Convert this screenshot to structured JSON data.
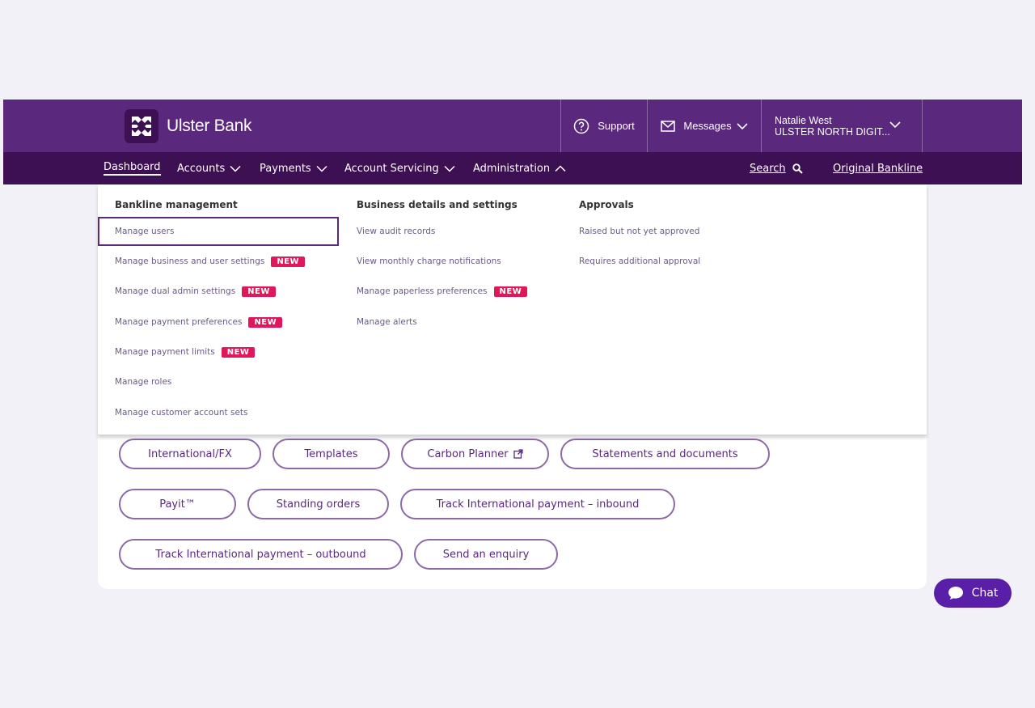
{
  "header": {
    "brand": "Ulster Bank",
    "support_label": "Support",
    "messages_label": "Messages",
    "user_name": "Natalie West",
    "company_name": "ULSTER NORTH DIGIT..."
  },
  "nav": {
    "dashboard": "Dashboard",
    "accounts": "Accounts",
    "payments": "Payments",
    "account_servicing": "Account Servicing",
    "administration": "Administration",
    "search": "Search",
    "original_bankline": "Original Bankline"
  },
  "dropdown": {
    "columns": [
      {
        "title": "Bankline management",
        "items": [
          {
            "label": "Manage users",
            "badge": ""
          },
          {
            "label": "Manage business and user settings",
            "badge": "NEW"
          },
          {
            "label": "Manage dual admin settings",
            "badge": "NEW"
          },
          {
            "label": "Manage payment preferences",
            "badge": "NEW"
          },
          {
            "label": "Manage payment limits",
            "badge": "NEW"
          },
          {
            "label": "Manage roles",
            "badge": ""
          },
          {
            "label": "Manage customer account sets",
            "badge": ""
          }
        ]
      },
      {
        "title": "Business details and settings",
        "items": [
          {
            "label": "View audit records",
            "badge": ""
          },
          {
            "label": "View monthly charge notifications",
            "badge": ""
          },
          {
            "label": "Manage paperless preferences",
            "badge": "NEW"
          },
          {
            "label": "Manage alerts",
            "badge": ""
          }
        ]
      },
      {
        "title": "Approvals",
        "items": [
          {
            "label": "Raised but not yet approved",
            "badge": ""
          },
          {
            "label": "Requires additional approval",
            "badge": ""
          }
        ]
      }
    ]
  },
  "quick_links": [
    "International/FX",
    "Templates",
    "Carbon Planner",
    "Statements and documents",
    "Payit™",
    "Standing orders",
    "Track International payment – inbound",
    "Track International payment – outbound",
    "Send an enquiry"
  ],
  "chat_label": "Chat",
  "colors": {
    "brand_purple": "#5a287d",
    "nav_purple": "#3c1053",
    "badge_pink": "#e0185a",
    "chat_purple": "#5a1fa8"
  }
}
